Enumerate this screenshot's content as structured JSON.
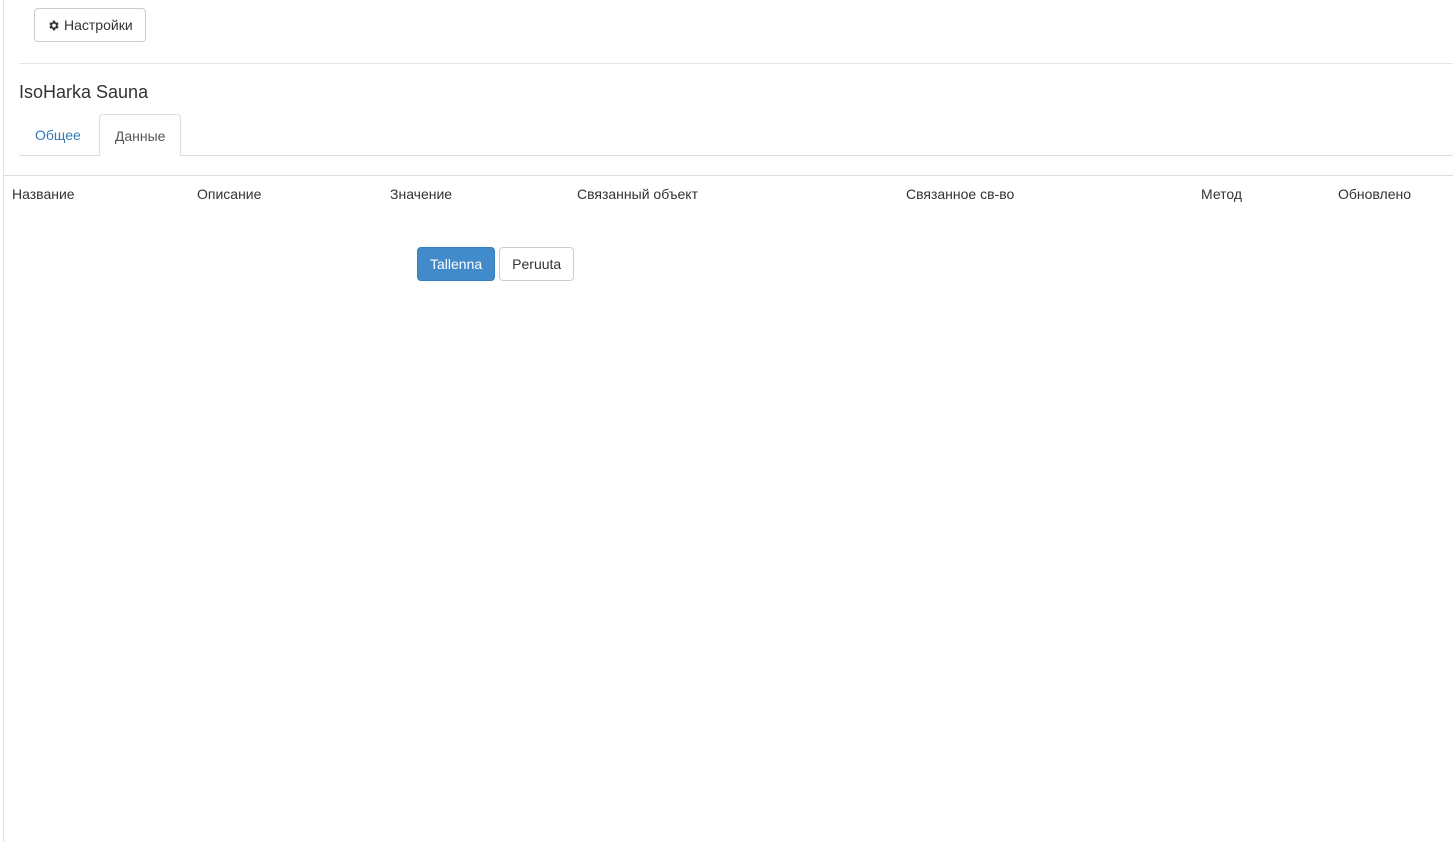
{
  "toolbar": {
    "settings_label": "Настройки",
    "settings_icon": "gear-icon"
  },
  "page": {
    "title": "IsoHarka Sauna"
  },
  "tabs": [
    {
      "label": "Общее",
      "active": false
    },
    {
      "label": "Данные",
      "active": true
    }
  ],
  "table": {
    "columns": [
      "Название",
      "Описание",
      "Значение",
      "Связанный объект",
      "Связанное св-во",
      "Метод",
      "Обновлено"
    ],
    "rows": []
  },
  "actions": {
    "save_label": "Tallenna",
    "cancel_label": "Peruuta"
  },
  "colors": {
    "primary": "#428bca",
    "link": "#337ab7"
  }
}
